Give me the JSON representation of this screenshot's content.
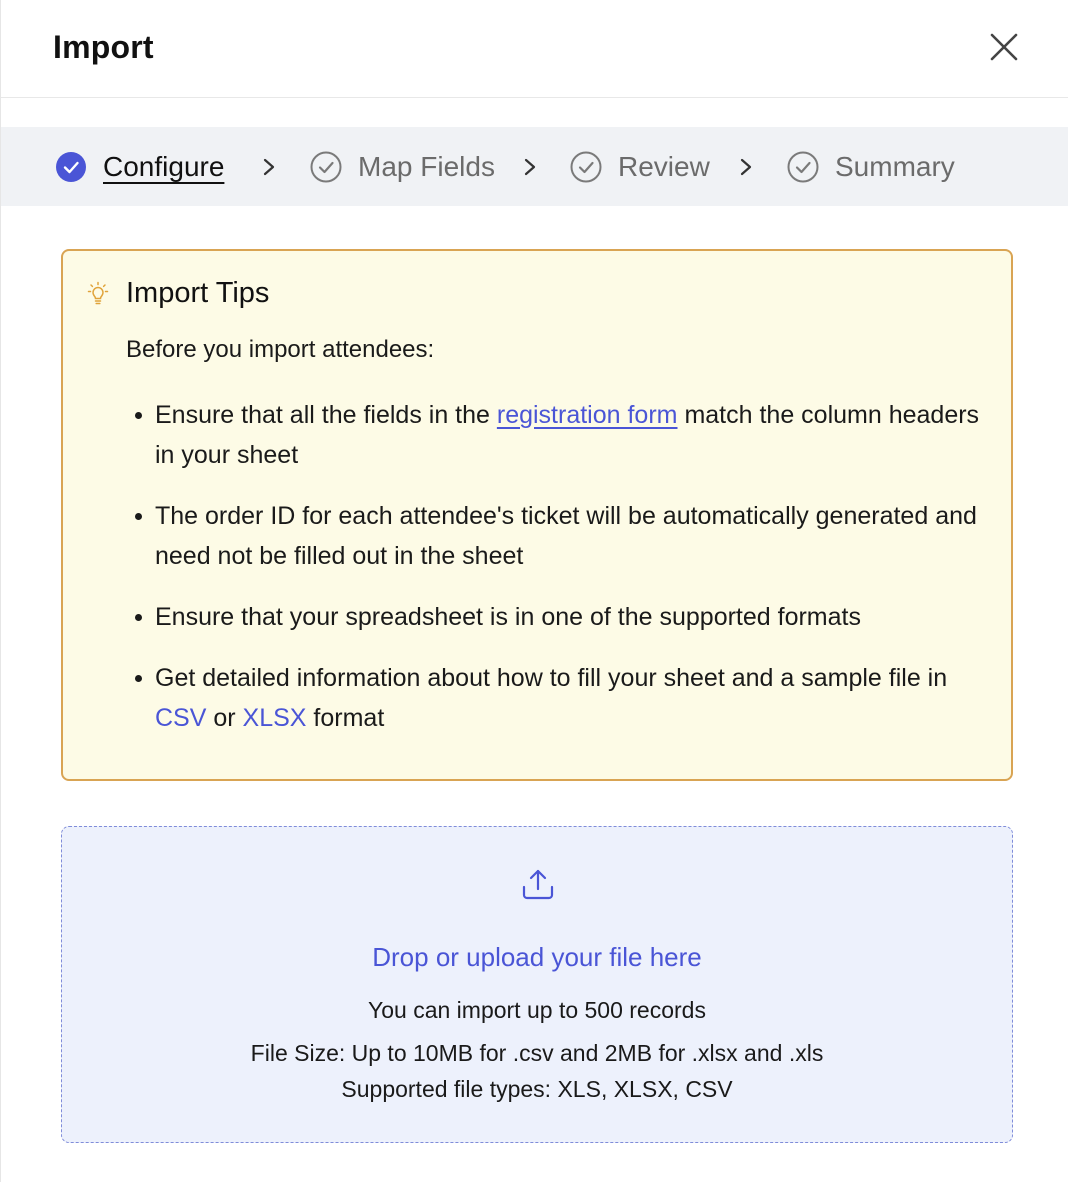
{
  "header": {
    "title": "Import",
    "close_icon": "close-icon"
  },
  "stepper": {
    "steps": [
      {
        "label": "Configure",
        "state": "active",
        "icon": "check-circle-filled-icon"
      },
      {
        "label": "Map Fields",
        "state": "inactive",
        "icon": "check-circle-outline-icon"
      },
      {
        "label": "Review",
        "state": "inactive",
        "icon": "check-circle-outline-icon"
      },
      {
        "label": "Summary",
        "state": "inactive",
        "icon": "check-circle-outline-icon"
      }
    ],
    "separator_icon": "chevron-right-icon"
  },
  "tips": {
    "icon": "lightbulb-icon",
    "title": "Import Tips",
    "intro": "Before you import attendees:",
    "item1_before": "Ensure that all the fields in the ",
    "item1_link": "registration form",
    "item1_after": " match the column headers in your sheet",
    "item2": "The order ID for each attendee's ticket will be automatically generated and need not be filled out in the sheet",
    "item3": "Ensure that your spreadsheet is in one of the supported formats",
    "item4_before": "Get detailed information about how to fill your sheet and a sample file in ",
    "item4_link_csv": "CSV",
    "item4_mid": " or ",
    "item4_link_xlsx": "XLSX",
    "item4_after": " format"
  },
  "upload": {
    "icon": "upload-icon",
    "cta": "Drop or upload your file here",
    "limit": "You can import up to 500 records",
    "size": "File Size: Up to 10MB for .csv and 2MB for .xlsx and .xls",
    "types": "Supported file types: XLS, XLSX, CSV"
  },
  "colors": {
    "accent": "#4a55d6",
    "tips_bg": "#fdfbe6",
    "tips_border": "#d9a453",
    "drop_bg": "#edf1fc",
    "stepper_bg": "#f0f2f5"
  }
}
